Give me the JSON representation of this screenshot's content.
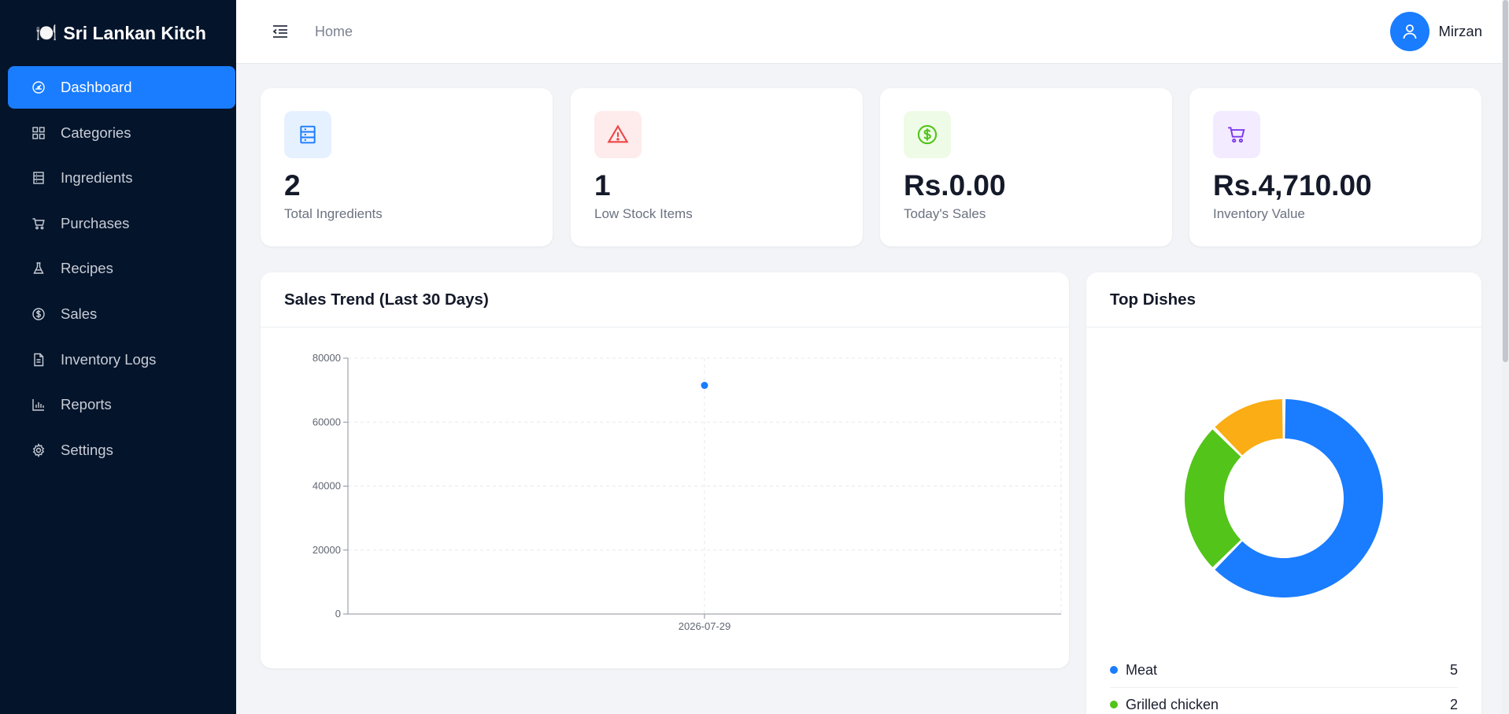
{
  "brand": {
    "logo": "🍽️",
    "name": "Sri Lankan Kitch"
  },
  "sidebar": {
    "items": [
      {
        "label": "Dashboard",
        "icon": "gauge-icon",
        "active": true
      },
      {
        "label": "Categories",
        "icon": "grid-icon"
      },
      {
        "label": "Ingredients",
        "icon": "list-icon"
      },
      {
        "label": "Purchases",
        "icon": "cart-icon"
      },
      {
        "label": "Recipes",
        "icon": "flask-icon"
      },
      {
        "label": "Sales",
        "icon": "dollar-icon"
      },
      {
        "label": "Inventory Logs",
        "icon": "document-icon"
      },
      {
        "label": "Reports",
        "icon": "bar-chart-icon"
      },
      {
        "label": "Settings",
        "icon": "gear-icon"
      }
    ]
  },
  "topbar": {
    "breadcrumb": "Home",
    "user_name": "Mirzan"
  },
  "stats": [
    {
      "value": "2",
      "label": "Total Ingredients",
      "icon": "server-icon",
      "color": "#1a7cff",
      "bg": "#e6f1ff"
    },
    {
      "value": "1",
      "label": "Low Stock Items",
      "icon": "warning-icon",
      "color": "#ef4444",
      "bg": "#fdeceb"
    },
    {
      "value": "Rs.0.00",
      "label": "Today's Sales",
      "icon": "dollar-circle-icon",
      "color": "#52c41a",
      "bg": "#eefbe6"
    },
    {
      "value": "Rs.4,710.00",
      "label": "Inventory Value",
      "icon": "cart-icon",
      "color": "#7c3aed",
      "bg": "#f3ebff"
    }
  ],
  "sales_panel": {
    "title": "Sales Trend (Last 30 Days)"
  },
  "dishes_panel": {
    "title": "Top Dishes",
    "legend": [
      {
        "name": "Meat",
        "count": "5",
        "color": "#1a7cff"
      },
      {
        "name": "Grilled chicken",
        "count": "2",
        "color": "#52c41a"
      }
    ]
  },
  "chart_data": [
    {
      "type": "scatter",
      "title": "Sales Trend (Last 30 Days)",
      "xlabel": "",
      "ylabel": "",
      "x": [
        "2026-07-29"
      ],
      "y": [
        71500
      ],
      "ylim": [
        0,
        80000
      ],
      "yticks": [
        "0",
        "20000",
        "40000",
        "60000",
        "80000"
      ],
      "grid": true,
      "color": "#1a7cff"
    },
    {
      "type": "pie",
      "title": "Top Dishes",
      "donut": true,
      "labels": [
        "Meat",
        "Grilled chicken",
        ""
      ],
      "values": [
        5,
        2,
        1
      ],
      "colors": [
        "#1a7cff",
        "#52c41a",
        "#faad14"
      ]
    }
  ]
}
